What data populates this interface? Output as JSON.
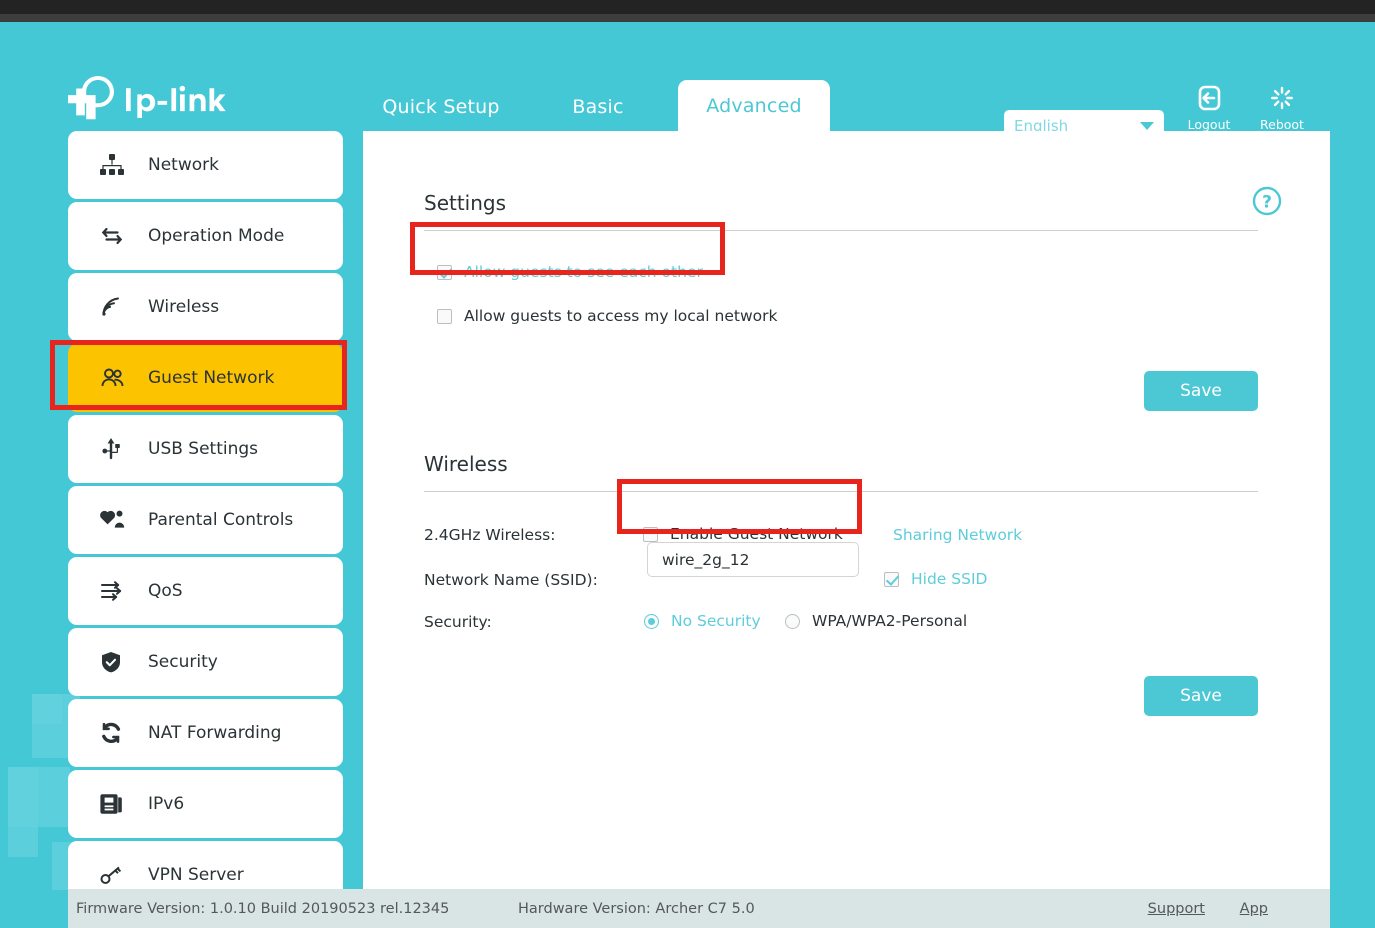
{
  "header": {
    "brand": "tp-link",
    "tabs": [
      {
        "label": "Quick Setup",
        "active": false
      },
      {
        "label": "Basic",
        "active": false
      },
      {
        "label": "Advanced",
        "active": true
      }
    ],
    "language": "English",
    "logout_label": "Logout",
    "reboot_label": "Reboot"
  },
  "sidebar": {
    "items": [
      {
        "label": "Network",
        "icon": "network-icon",
        "active": false
      },
      {
        "label": "Operation Mode",
        "icon": "operation-mode-icon",
        "active": false
      },
      {
        "label": "Wireless",
        "icon": "wireless-icon",
        "active": false
      },
      {
        "label": "Guest Network",
        "icon": "guest-network-icon",
        "active": true
      },
      {
        "label": "USB Settings",
        "icon": "usb-icon",
        "active": false
      },
      {
        "label": "Parental Controls",
        "icon": "parental-controls-icon",
        "active": false
      },
      {
        "label": "QoS",
        "icon": "qos-icon",
        "active": false
      },
      {
        "label": "Security",
        "icon": "security-icon",
        "active": false
      },
      {
        "label": "NAT Forwarding",
        "icon": "nat-forwarding-icon",
        "active": false
      },
      {
        "label": "IPv6",
        "icon": "ipv6-icon",
        "active": false
      },
      {
        "label": "VPN Server",
        "icon": "vpn-server-icon",
        "active": false
      }
    ]
  },
  "settings": {
    "title": "Settings",
    "allow_see_each_other": {
      "label": "Allow guests to see each other",
      "checked": true,
      "highlighted": true
    },
    "allow_local_network": {
      "label": "Allow guests to access my local network",
      "checked": false,
      "highlighted": false
    },
    "save_label": "Save"
  },
  "wireless": {
    "title": "Wireless",
    "band_label": "2.4GHz Wireless:",
    "enable_guest_label": "Enable Guest Network",
    "enable_guest_checked": false,
    "sharing_network_label": "Sharing Network",
    "ssid_label": "Network Name (SSID):",
    "ssid_value": "wire_2g_12",
    "ssid_placeholder": "",
    "hide_ssid_label": "Hide SSID",
    "hide_ssid_checked": true,
    "security_label": "Security:",
    "security_options": [
      {
        "label": "No Security",
        "selected": true
      },
      {
        "label": "WPA/WPA2-Personal",
        "selected": false
      }
    ],
    "save_label": "Save"
  },
  "footer": {
    "firmware": "Firmware Version: 1.0.10 Build 20190523 rel.12345",
    "hardware": "Hardware Version: Archer C7 5.0",
    "support_label": "Support",
    "app_label": "App"
  },
  "colors": {
    "brand_teal": "#44c8d6",
    "accent_teal": "#5ecdda",
    "active_highlight": "#fcc300",
    "annotation_red": "#e8251c",
    "footer_bg": "#d9e5e4"
  }
}
